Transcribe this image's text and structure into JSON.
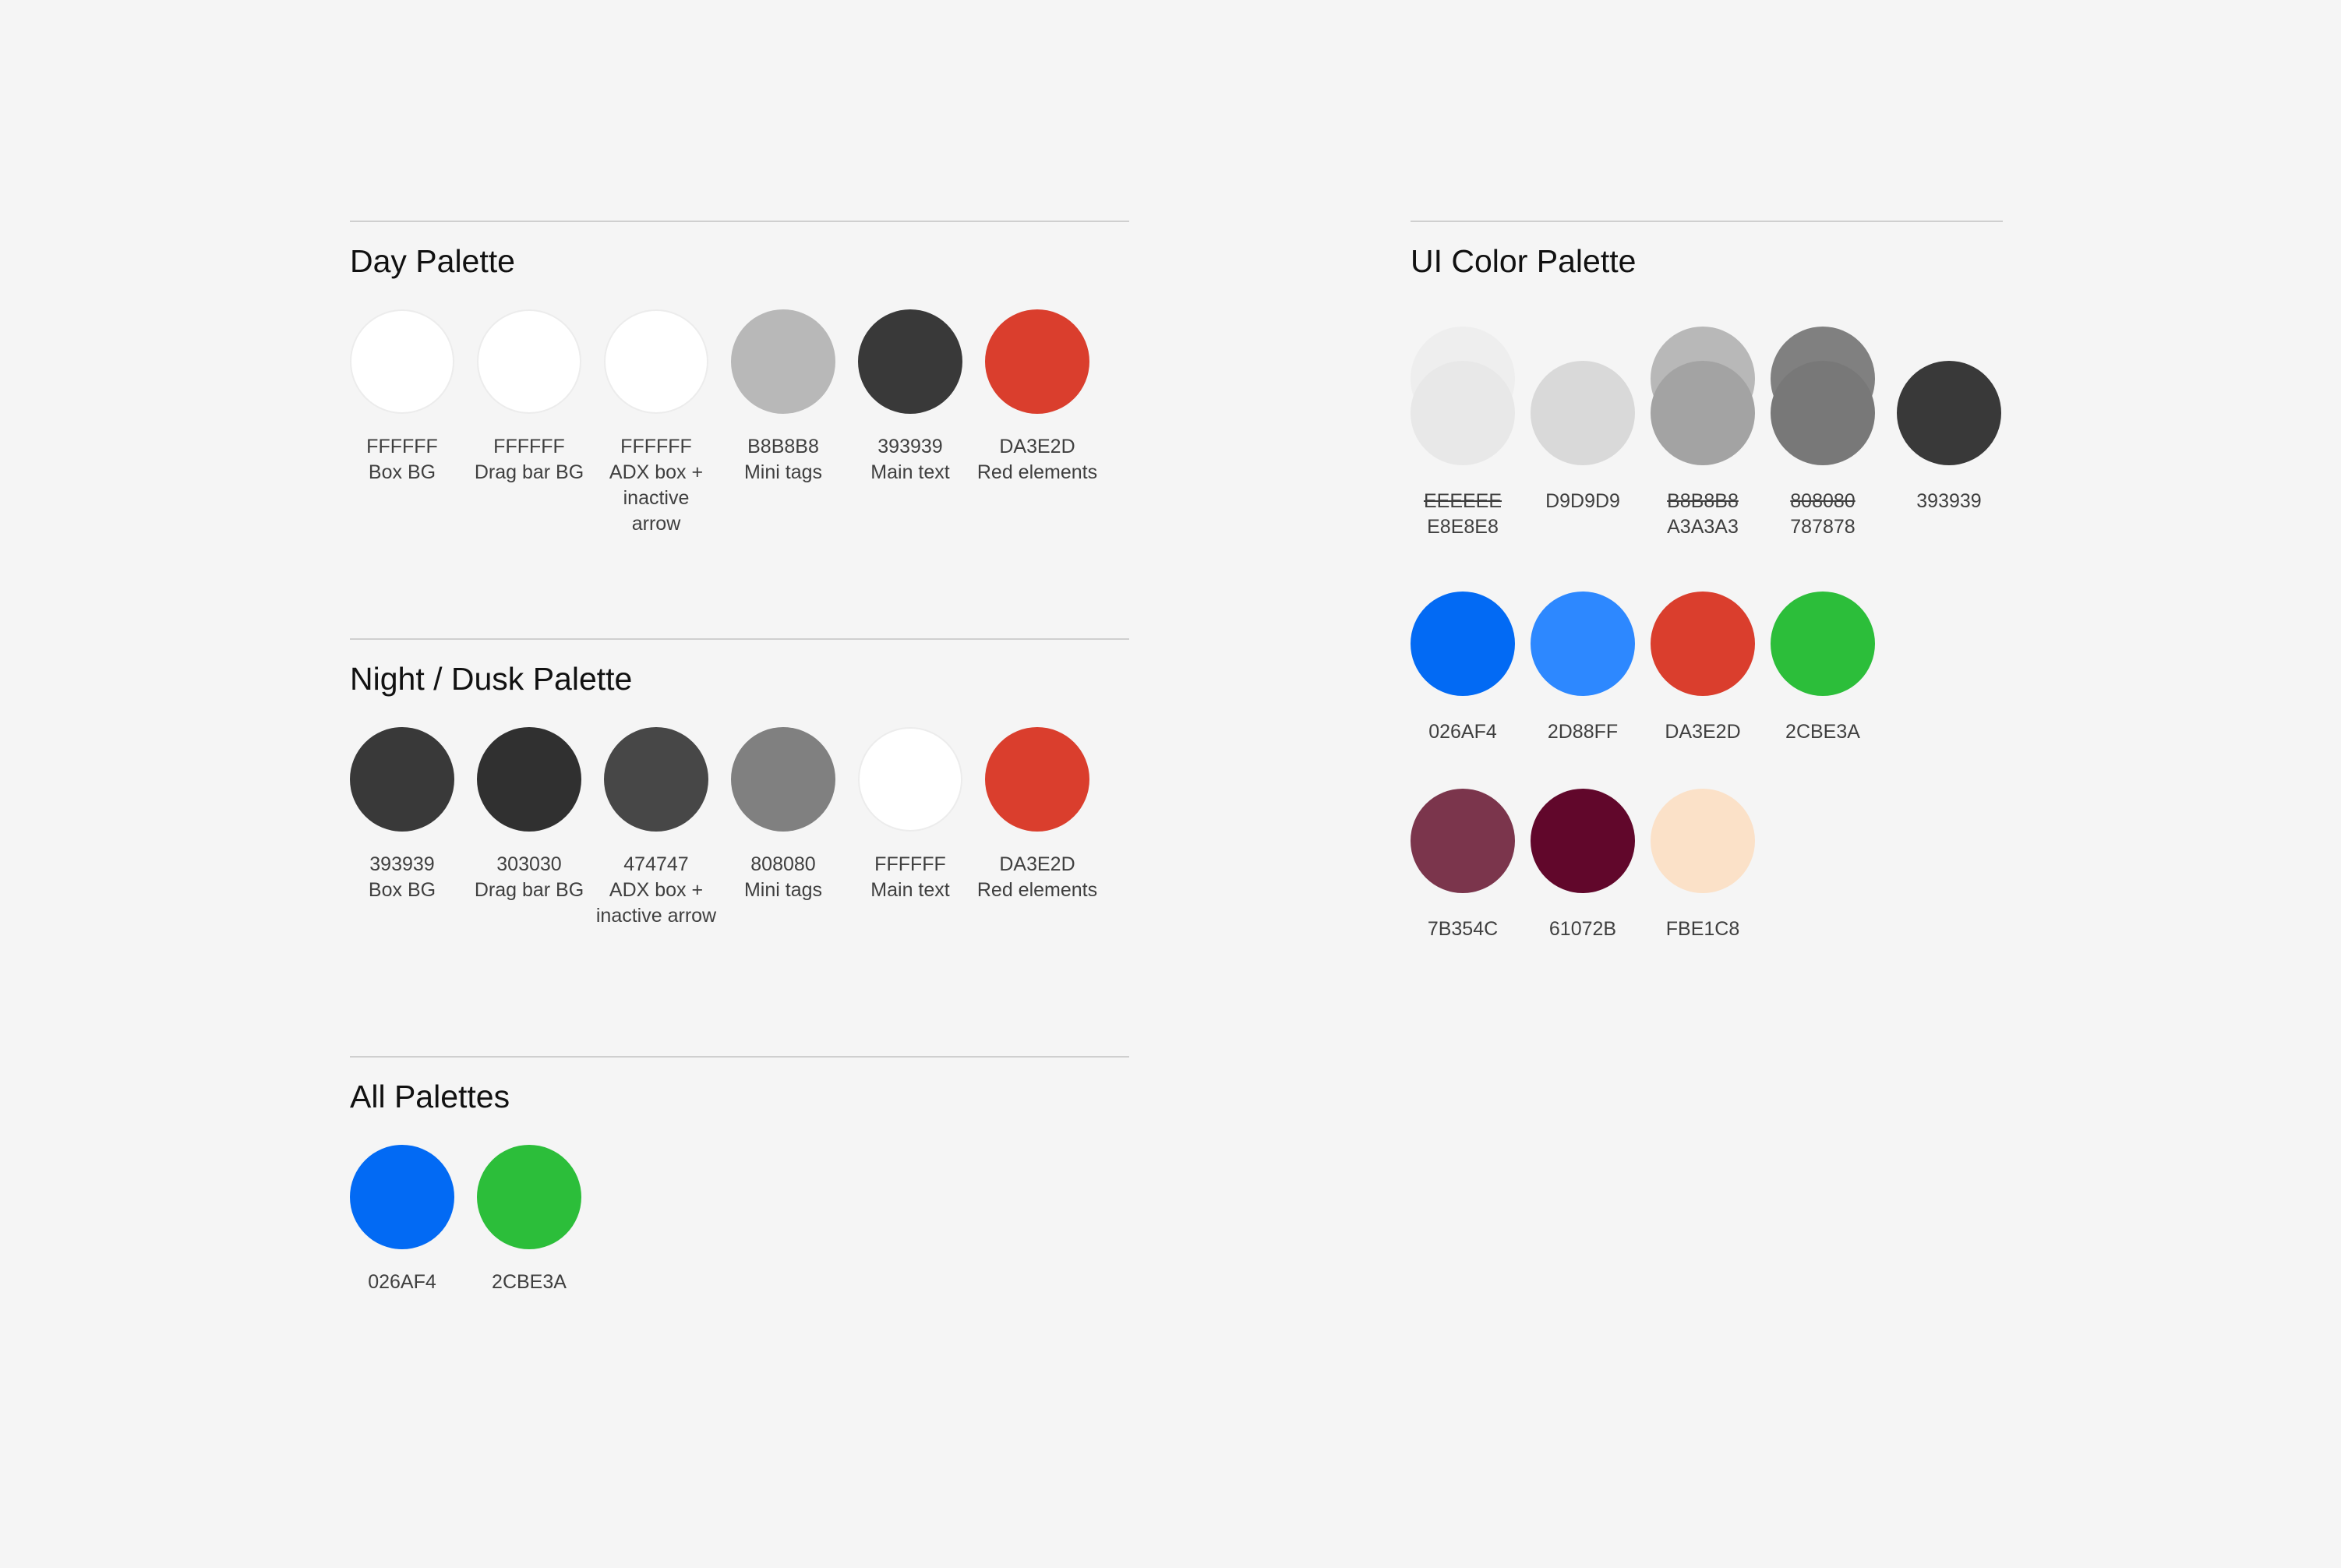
{
  "page": {
    "background": "#F5F5F5"
  },
  "day_palette": {
    "title": "Day Palette",
    "swatches": [
      {
        "color": "#FFFFFF",
        "hex": "FFFFFF",
        "desc": "Box BG"
      },
      {
        "color": "#FFFFFF",
        "hex": "FFFFFF",
        "desc": "Drag bar BG"
      },
      {
        "color": "#FFFFFF",
        "hex": "FFFFFF",
        "desc_lines": [
          "ADX box +",
          "inactive",
          "arrow"
        ]
      },
      {
        "color": "#B8B8B8",
        "hex": "B8B8B8",
        "desc": "Mini tags"
      },
      {
        "color": "#393939",
        "hex": "393939",
        "desc": "Main text"
      },
      {
        "color": "#DA3E2D",
        "hex": "DA3E2D",
        "desc": "Red elements"
      }
    ]
  },
  "night_palette": {
    "title": "Night / Dusk Palette",
    "swatches": [
      {
        "color": "#393939",
        "hex": "393939",
        "desc": "Box BG"
      },
      {
        "color": "#303030",
        "hex": "303030",
        "desc": "Drag bar BG"
      },
      {
        "color": "#474747",
        "hex": "474747",
        "desc_lines": [
          "ADX box +",
          "inactive arrow"
        ]
      },
      {
        "color": "#808080",
        "hex": "808080",
        "desc": "Mini tags"
      },
      {
        "color": "#FFFFFF",
        "hex": "FFFFFF",
        "desc": "Main text"
      },
      {
        "color": "#DA3E2D",
        "hex": "DA3E2D",
        "desc": "Red elements"
      }
    ]
  },
  "all_palettes": {
    "title": "All Palettes",
    "swatches": [
      {
        "color": "#026AF4",
        "hex": "026AF4"
      },
      {
        "color": "#2CBE3A",
        "hex": "2CBE3A"
      }
    ]
  },
  "ui_palette": {
    "title": "UI Color Palette",
    "rows": [
      [
        {
          "old_color": "#EEEEEE",
          "old_hex": "EEEEEE",
          "color": "#E8E8E8",
          "hex": "E8E8E8"
        },
        {
          "color": "#D9D9D9",
          "hex": "D9D9D9"
        },
        {
          "old_color": "#B8B8B8",
          "old_hex": "B8B8B8",
          "color": "#A3A3A3",
          "hex": "A3A3A3"
        },
        {
          "old_color": "#808080",
          "old_hex": "808080",
          "color": "#787878",
          "hex": "787878"
        },
        {
          "color": "#393939",
          "hex": "393939"
        }
      ],
      [
        {
          "color": "#026AF4",
          "hex": "026AF4"
        },
        {
          "color": "#2D88FF",
          "hex": "2D88FF"
        },
        {
          "color": "#DA3E2D",
          "hex": "DA3E2D"
        },
        {
          "color": "#2CBE3A",
          "hex": "2CBE3A"
        }
      ],
      [
        {
          "color": "#7B354C",
          "hex": "7B354C"
        },
        {
          "color": "#61072B",
          "hex": "61072B"
        },
        {
          "color": "#FBE1C8",
          "hex": "FBE1C8"
        }
      ]
    ]
  }
}
